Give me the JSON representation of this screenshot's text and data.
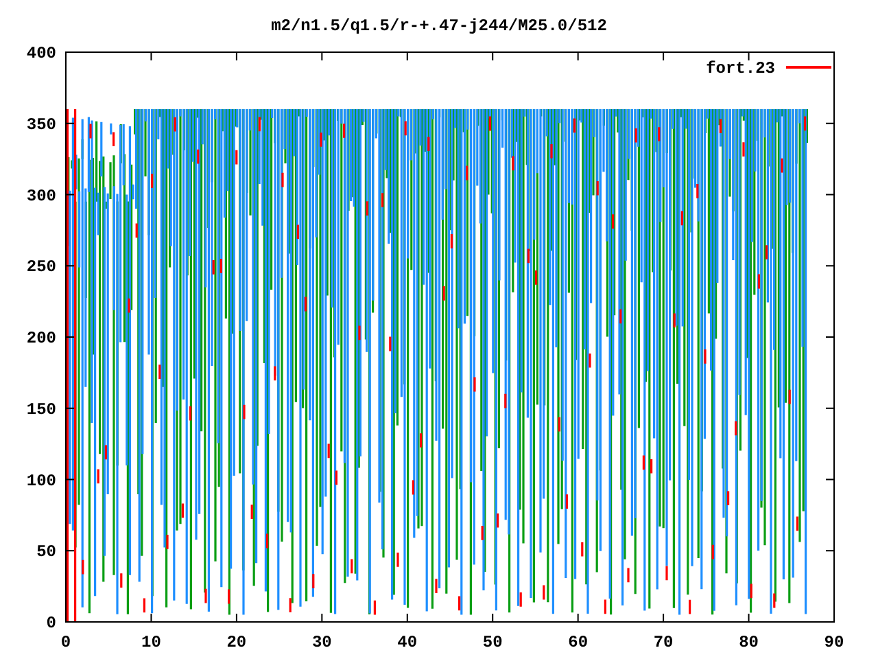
{
  "plot": {
    "title": "m2/n1.5/q1.5/r-+.47-j244/M25.0/512",
    "y_axis_labels": [
      "400",
      "350",
      "300",
      "250",
      "200",
      "150",
      "100",
      "50",
      "0"
    ],
    "x_axis_labels": [
      "0",
      "10",
      "20",
      "30",
      "40",
      "50",
      "60",
      "70",
      "80",
      "90"
    ],
    "legend": [
      {
        "label": "fort.23",
        "color": "#ff0000"
      }
    ]
  }
}
